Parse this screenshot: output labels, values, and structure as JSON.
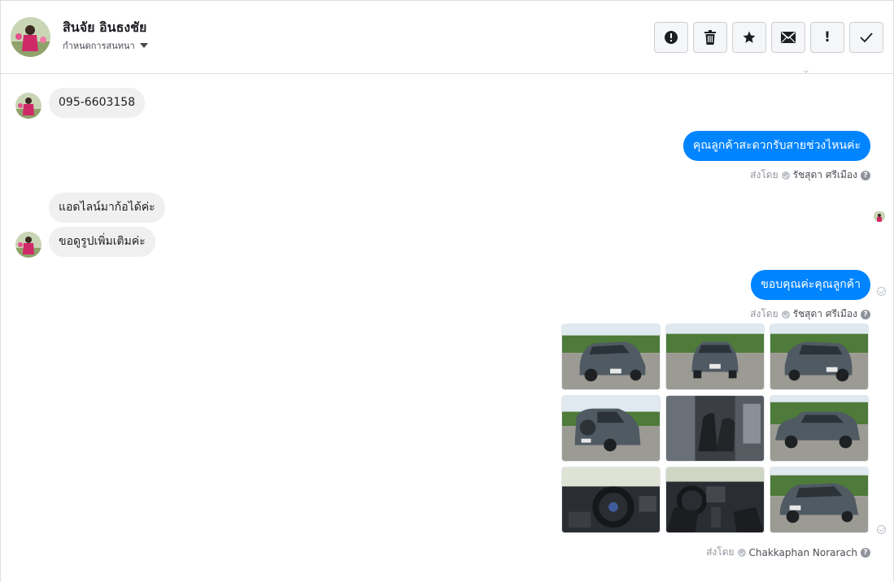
{
  "header": {
    "contact_name": "สินจัย อินธงชัย",
    "conversation_menu": "กำหนดการสนทนา",
    "toolbar": [
      {
        "name": "report-button",
        "icon": "alert-circle-icon"
      },
      {
        "name": "delete-button",
        "icon": "trash-icon"
      },
      {
        "name": "star-button",
        "icon": "star-icon"
      },
      {
        "name": "mark-unread-button",
        "icon": "envelope-icon"
      },
      {
        "name": "important-button",
        "icon": "exclamation-icon",
        "label": "!"
      },
      {
        "name": "done-button",
        "icon": "check-icon"
      }
    ]
  },
  "messages": {
    "m1": "095-6603158",
    "m2": "คุณลูกค้าสะดวกรับสายช่วงไหนค่ะ",
    "m2_sent_by_label": "ส่งโดย",
    "m2_sender": "รัชสุดา ศรีเมือง",
    "m3": "แอดไลน์มาก้อได้ค่ะ",
    "m4": "ขอดูรูปเพิ่มเติมค่ะ",
    "m5": "ขอบคุณค่ะคุณลูกค้า",
    "m5_sent_by_label": "ส่งโดย",
    "m5_sender": "รัชสุดา ศรีเมือง",
    "m6_sent_by_label": "ส่งโดย",
    "m6_sender": "Chakkaphan Norarach",
    "help_glyph": "?"
  },
  "photos": [
    {
      "view": "front-left",
      "desc": "car-photo-1"
    },
    {
      "view": "front",
      "desc": "car-photo-2"
    },
    {
      "view": "front-right",
      "desc": "car-photo-3"
    },
    {
      "view": "rear-left",
      "desc": "car-photo-4"
    },
    {
      "view": "interior-seat",
      "desc": "car-photo-5"
    },
    {
      "view": "side",
      "desc": "car-photo-6"
    },
    {
      "view": "dashboard",
      "desc": "car-photo-7"
    },
    {
      "view": "console",
      "desc": "car-photo-8"
    },
    {
      "view": "front-left-2",
      "desc": "car-photo-9"
    }
  ],
  "colors": {
    "outgoing_bubble": "#0084ff",
    "incoming_bubble": "#f1f0f0",
    "car_body": "#4f5a63",
    "sky": "#dfe9ef",
    "trees": "#4e7a3a",
    "ground": "#9b9a93"
  }
}
